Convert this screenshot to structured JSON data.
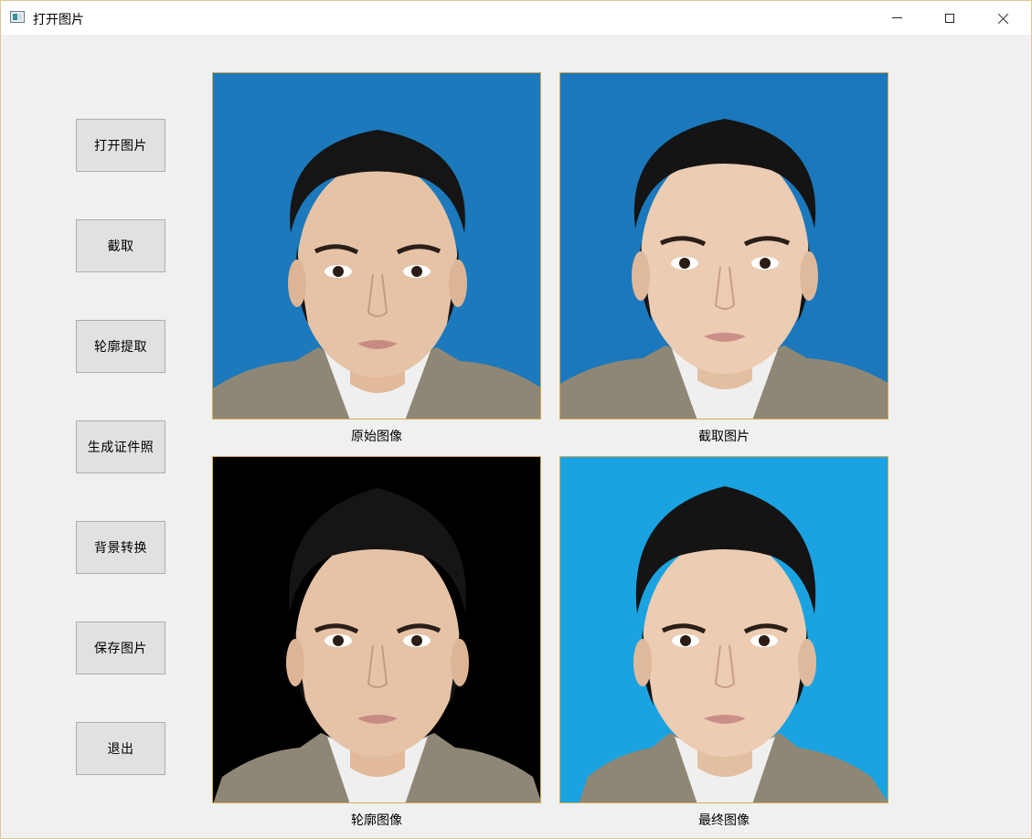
{
  "window": {
    "title": "打开图片"
  },
  "buttons": {
    "open": "打开图片",
    "crop": "截取",
    "contour": "轮廓提取",
    "generate": "生成证件照",
    "background": "背景转换",
    "save": "保存图片",
    "exit": "退出"
  },
  "images": {
    "original": {
      "caption": "原始图像",
      "background": "#1c79bb"
    },
    "cropped": {
      "caption": "截取图片",
      "background": "#1b78bc"
    },
    "contour": {
      "caption": "轮廓图像",
      "background": "#000000"
    },
    "final": {
      "caption": "最终图像",
      "background": "#1aa3e0"
    }
  },
  "icons": {
    "app": "app-window-icon",
    "minimize": "minimize-icon",
    "maximize": "maximize-icon",
    "close": "close-icon"
  }
}
